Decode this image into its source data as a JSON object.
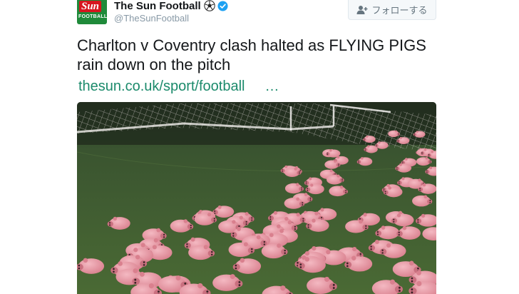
{
  "account": {
    "display_name": "The Sun Football",
    "handle": "@TheSunFootball",
    "avatar_logo_text": "Sun",
    "avatar_sub_text": "FOOTBALL"
  },
  "follow_button": {
    "label": "フォローする"
  },
  "tweet": {
    "text": "Charlton v Coventry clash halted as FLYING PIGS rain down on the pitch",
    "link_text": "thesun.co.uk/sport/football",
    "link_ellipsis": "…"
  },
  "media": {
    "description_icon": "photo-of-toy-pigs-on-football-pitch",
    "colors": {
      "grass": "#3f5a2c",
      "pig": "#e79aa6",
      "net": "#e8e2e2"
    }
  },
  "colors": {
    "link": "#1b8a6b",
    "muted": "#8899a6",
    "verified": "#1da1f2"
  }
}
